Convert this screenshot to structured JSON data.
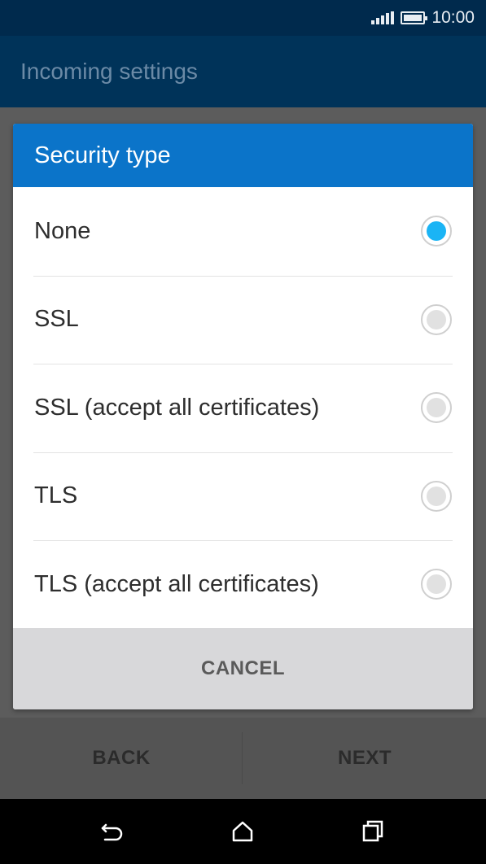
{
  "status_bar": {
    "time": "10:00",
    "icons": [
      "signal-icon",
      "battery-icon"
    ]
  },
  "app_bar": {
    "title": "Incoming settings"
  },
  "dialog": {
    "title": "Security type",
    "options": [
      {
        "label": "None",
        "selected": true
      },
      {
        "label": "SSL",
        "selected": false
      },
      {
        "label": "SSL (accept all certificates)",
        "selected": false
      },
      {
        "label": "TLS",
        "selected": false
      },
      {
        "label": "TLS (accept all certificates)",
        "selected": false
      }
    ],
    "cancel_label": "CANCEL"
  },
  "bottom_actions": {
    "back_label": "BACK",
    "next_label": "NEXT"
  },
  "nav_bar": {
    "icons": [
      "back-icon",
      "home-icon",
      "recents-icon"
    ]
  },
  "colors": {
    "dialog_header": "#0b74c9",
    "radio_selected": "#1ab4f5",
    "status_bar": "#002a4d"
  }
}
